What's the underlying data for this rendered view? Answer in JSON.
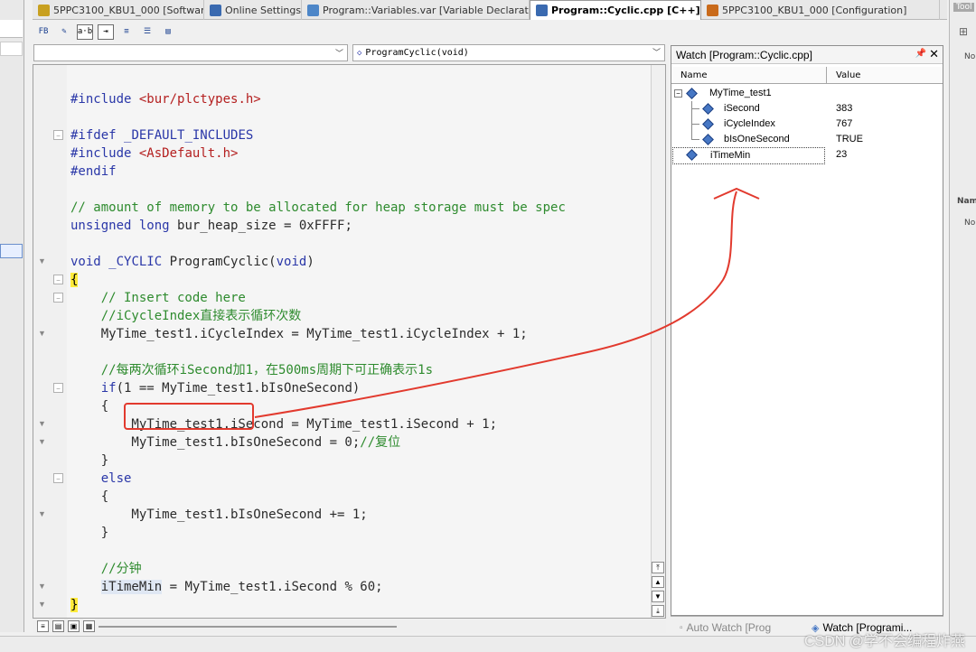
{
  "tabs": [
    {
      "label": "5PPC3100_KBU1_000 [Software]",
      "icon": "software-icon",
      "active": false
    },
    {
      "label": "Online Settings",
      "icon": "monitor-icon",
      "active": false
    },
    {
      "label": "Program::Variables.var [Variable Declaration]",
      "icon": "variable-file-icon",
      "active": false
    },
    {
      "label": "Program::Cyclic.cpp [C++]",
      "icon": "cpp-file-icon",
      "active": true
    },
    {
      "label": "5PPC3100_KBU1_000 [Configuration]",
      "icon": "configuration-icon",
      "active": false
    }
  ],
  "toolbar": {
    "buttons": [
      {
        "name": "insert-fb-icon",
        "glyph": "FB"
      },
      {
        "name": "pencil-icon",
        "glyph": "✎"
      },
      {
        "name": "ab-spell-icon",
        "glyph": "a·b"
      },
      {
        "name": "indent-icon",
        "glyph": "⇥"
      },
      {
        "name": "outdent-icon",
        "glyph": "≡"
      },
      {
        "name": "list-icon",
        "glyph": "☰"
      },
      {
        "name": "page-icon",
        "glyph": "▤"
      }
    ]
  },
  "function_selector": {
    "scope_value": "",
    "function_value": "ProgramCyclic(void)"
  },
  "editor": {
    "lines": [
      {
        "n": 1,
        "fold": "",
        "html": ""
      },
      {
        "n": 2,
        "fold": "",
        "html": "<span class=\"kw\">#include</span> <span class=\"str\">&lt;bur/plctypes.h&gt;</span>"
      },
      {
        "n": 3,
        "fold": "",
        "html": ""
      },
      {
        "n": 4,
        "fold": "box",
        "html": "<span class=\"kw\">#ifdef</span> <span class=\"kw\">_DEFAULT_INCLUDES</span>"
      },
      {
        "n": 5,
        "fold": "",
        "html": "<span class=\"kw\">#include</span> <span class=\"str\">&lt;AsDefault.h&gt;</span>"
      },
      {
        "n": 6,
        "fold": "",
        "html": "<span class=\"kw\">#endif</span>"
      },
      {
        "n": 7,
        "fold": "",
        "html": ""
      },
      {
        "n": 8,
        "fold": "",
        "html": "<span class=\"cm\">// amount of memory to be allocated for heap storage must be spec</span>"
      },
      {
        "n": 9,
        "fold": "",
        "html": "<span class=\"kw\">unsigned</span> <span class=\"kw\">long</span> bur_heap_size = 0xFFFF;"
      },
      {
        "n": 10,
        "fold": "",
        "html": ""
      },
      {
        "n": 11,
        "fold": "tri",
        "html": "<span class=\"kw\">void</span> <span class=\"kw\">_CYCLIC</span> ProgramCyclic(<span class=\"kw\">void</span>)"
      },
      {
        "n": 12,
        "fold": "box",
        "html": "<span class=\"brace\">{</span>"
      },
      {
        "n": 13,
        "fold": "box",
        "html": "    <span class=\"cm\">// Insert code here</span>"
      },
      {
        "n": 14,
        "fold": "",
        "html": "    <span class=\"cm\">//iCycleIndex直接表示循环次数</span>"
      },
      {
        "n": 15,
        "fold": "tri",
        "html": "    MyTime_test1.iCycleIndex = MyTime_test1.iCycleIndex + 1;"
      },
      {
        "n": 16,
        "fold": "",
        "html": ""
      },
      {
        "n": 17,
        "fold": "",
        "html": "    <span class=\"cm\">//每两次循环iSecond加1，在500ms周期下可正确表示1s</span>"
      },
      {
        "n": 18,
        "fold": "box",
        "html": "    <span class=\"kw\">if</span>(1 == MyTime_test1.bIsOneSecond)"
      },
      {
        "n": 19,
        "fold": "",
        "html": "    {"
      },
      {
        "n": 20,
        "fold": "tri",
        "html": "        MyTime_test1.iSecond = MyTime_test1.iSecond + 1;"
      },
      {
        "n": 21,
        "fold": "tri",
        "html": "        MyTime_test1.bIsOneSecond = 0;<span class=\"cm\">//复位</span>"
      },
      {
        "n": 22,
        "fold": "",
        "html": "    }"
      },
      {
        "n": 23,
        "fold": "box",
        "html": "    <span class=\"kw\">else</span>"
      },
      {
        "n": 24,
        "fold": "",
        "html": "    {"
      },
      {
        "n": 25,
        "fold": "tri",
        "html": "        MyTime_test1.bIsOneSecond += 1;"
      },
      {
        "n": 26,
        "fold": "",
        "html": "    }"
      },
      {
        "n": 27,
        "fold": "",
        "html": ""
      },
      {
        "n": 28,
        "fold": "",
        "html": "    <span class=\"cm\">//分钟</span>"
      },
      {
        "n": 29,
        "fold": "tri",
        "html": "    <span class=\"hl\">iTimeMin</span> = MyTime_test1.iSecond % 60;"
      },
      {
        "n": 30,
        "fold": "tri",
        "html": "<span class=\"brace\">}</span>"
      }
    ]
  },
  "watch": {
    "title": "Watch [Program::Cyclic.cpp]",
    "col_name": "Name",
    "col_value": "Value",
    "rows": [
      {
        "name": "MyTime_test1",
        "value": "",
        "level": 0,
        "expand": "−"
      },
      {
        "name": "iSecond",
        "value": "383",
        "level": 1
      },
      {
        "name": "iCycleIndex",
        "value": "767",
        "level": 1
      },
      {
        "name": "bIsOneSecond",
        "value": "TRUE",
        "level": 1
      },
      {
        "name": "iTimeMin",
        "value": "23",
        "level": 0,
        "selected": true
      }
    ],
    "tabs": [
      {
        "label": "Auto Watch [Prog"
      },
      {
        "label": "Watch [Programi..."
      }
    ]
  },
  "right_panel": {
    "title": "Tool",
    "no_items_1": "No",
    "col_name": "Nam",
    "no_items_2": "No"
  },
  "watermark": "CSDN @学不会编程炸燕",
  "annotation": {
    "color": "#e23a2e"
  }
}
